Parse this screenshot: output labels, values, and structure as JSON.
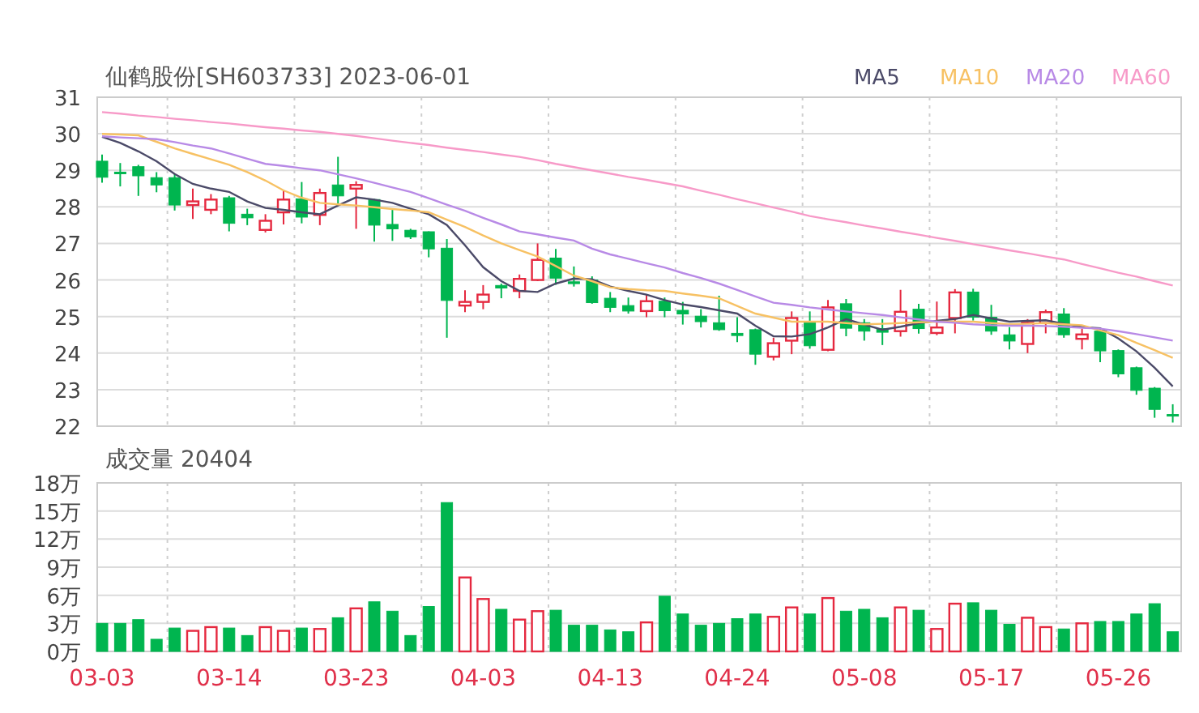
{
  "title": "仙鹤股份[SH603733] 2023-06-01",
  "price_chart": {
    "chart_data": {
      "type": "candlestick",
      "grid": true,
      "ylim": [
        22,
        31
      ],
      "yticks": [
        22,
        23,
        24,
        25,
        26,
        27,
        28,
        29,
        30,
        31
      ],
      "ohlc": [
        [
          29.25,
          29.43,
          28.66,
          28.81
        ],
        [
          28.95,
          29.2,
          28.56,
          28.92
        ],
        [
          29.1,
          29.15,
          28.3,
          28.85
        ],
        [
          28.8,
          28.95,
          28.4,
          28.6
        ],
        [
          28.8,
          28.9,
          27.9,
          28.05
        ],
        [
          28.05,
          28.5,
          27.67,
          28.15
        ],
        [
          27.92,
          28.35,
          27.8,
          28.2
        ],
        [
          28.25,
          28.3,
          27.33,
          27.55
        ],
        [
          27.8,
          27.95,
          27.5,
          27.7
        ],
        [
          27.37,
          27.8,
          27.3,
          27.62
        ],
        [
          27.85,
          28.45,
          27.52,
          28.2
        ],
        [
          28.22,
          28.68,
          27.55,
          27.72
        ],
        [
          27.78,
          28.5,
          27.5,
          28.38
        ],
        [
          28.6,
          29.37,
          28.05,
          28.3
        ],
        [
          28.5,
          28.7,
          27.4,
          28.6
        ],
        [
          28.2,
          28.22,
          27.05,
          27.5
        ],
        [
          27.52,
          27.95,
          27.07,
          27.4
        ],
        [
          27.36,
          27.4,
          27.12,
          27.18
        ],
        [
          27.32,
          27.33,
          26.62,
          26.85
        ],
        [
          26.87,
          27.12,
          24.42,
          25.44
        ],
        [
          25.3,
          25.72,
          25.12,
          25.4
        ],
        [
          25.4,
          25.86,
          25.2,
          25.6
        ],
        [
          25.85,
          25.9,
          25.5,
          25.78
        ],
        [
          25.7,
          26.15,
          25.5,
          26.03
        ],
        [
          26.0,
          27.0,
          25.97,
          26.55
        ],
        [
          26.6,
          26.85,
          25.87,
          26.05
        ],
        [
          25.95,
          26.37,
          25.82,
          25.9
        ],
        [
          26.0,
          26.1,
          25.35,
          25.38
        ],
        [
          25.5,
          25.67,
          25.12,
          25.25
        ],
        [
          25.3,
          25.52,
          25.08,
          25.15
        ],
        [
          25.15,
          25.6,
          24.98,
          25.42
        ],
        [
          25.42,
          25.52,
          24.98,
          25.16
        ],
        [
          25.17,
          25.4,
          24.78,
          25.07
        ],
        [
          25.01,
          25.2,
          24.7,
          24.86
        ],
        [
          24.83,
          25.57,
          24.61,
          24.64
        ],
        [
          24.54,
          24.98,
          24.3,
          24.48
        ],
        [
          24.64,
          24.67,
          23.68,
          23.97
        ],
        [
          23.9,
          24.42,
          23.8,
          24.27
        ],
        [
          24.34,
          25.14,
          23.97,
          24.96
        ],
        [
          24.87,
          25.14,
          24.12,
          24.2
        ],
        [
          24.09,
          25.45,
          24.05,
          25.25
        ],
        [
          25.35,
          25.48,
          24.46,
          24.68
        ],
        [
          24.83,
          24.93,
          24.34,
          24.6
        ],
        [
          24.67,
          24.93,
          24.22,
          24.57
        ],
        [
          24.6,
          25.73,
          24.45,
          25.13
        ],
        [
          25.2,
          25.35,
          24.53,
          24.67
        ],
        [
          24.55,
          25.41,
          24.49,
          24.7
        ],
        [
          24.96,
          25.75,
          24.54,
          25.66
        ],
        [
          25.67,
          25.76,
          24.89,
          24.98
        ],
        [
          24.98,
          25.32,
          24.5,
          24.6
        ],
        [
          24.5,
          24.71,
          24.1,
          24.33
        ],
        [
          24.25,
          24.93,
          24.0,
          24.83
        ],
        [
          24.82,
          25.19,
          24.54,
          25.12
        ],
        [
          25.07,
          25.23,
          24.42,
          24.5
        ],
        [
          24.39,
          24.67,
          24.1,
          24.51
        ],
        [
          24.6,
          24.67,
          23.75,
          24.06
        ],
        [
          24.07,
          24.1,
          23.34,
          23.43
        ],
        [
          23.6,
          23.63,
          22.86,
          22.98
        ],
        [
          23.04,
          23.07,
          22.23,
          22.46
        ],
        [
          22.32,
          22.6,
          22.1,
          22.3
        ]
      ]
    },
    "moving_averages": {
      "chart_data": {
        "type": "line",
        "ylim": [
          22,
          31
        ],
        "series": [
          {
            "name": "MA5",
            "color": "#4b4a68",
            "values": [
              29.92,
              29.75,
              29.52,
              29.25,
              28.9,
              28.63,
              28.5,
              28.41,
              28.15,
              27.97,
              27.92,
              27.85,
              27.8,
              28.04,
              28.26,
              28.2,
              28.11,
              27.95,
              27.8,
              27.5,
              26.95,
              26.35,
              25.97,
              25.7,
              25.67,
              25.9,
              26.04,
              26.02,
              25.82,
              25.7,
              25.6,
              25.45,
              25.33,
              25.26,
              25.17,
              25.08,
              24.75,
              24.46,
              24.45,
              24.52,
              24.7,
              24.93,
              24.78,
              24.64,
              24.72,
              24.82,
              24.88,
              24.93,
              25.04,
              24.95,
              24.86,
              24.88,
              24.9,
              24.8,
              24.71,
              24.68,
              24.4,
              24.05,
              23.6,
              23.09
            ]
          },
          {
            "name": "MA10",
            "color": "#f7c163",
            "values": [
              30.0,
              29.98,
              29.96,
              29.78,
              29.6,
              29.45,
              29.3,
              29.15,
              28.95,
              28.72,
              28.45,
              28.25,
              28.11,
              28.07,
              28.04,
              27.99,
              27.94,
              27.9,
              27.85,
              27.65,
              27.45,
              27.22,
              27.0,
              26.82,
              26.64,
              26.38,
              26.12,
              25.97,
              25.8,
              25.75,
              25.72,
              25.7,
              25.63,
              25.57,
              25.5,
              25.29,
              25.08,
              24.97,
              24.86,
              24.86,
              24.86,
              24.82,
              24.79,
              24.8,
              24.82,
              24.84,
              24.86,
              24.86,
              24.86,
              24.82,
              24.79,
              24.8,
              24.82,
              24.79,
              24.76,
              24.62,
              24.49,
              24.28,
              24.08,
              23.87
            ]
          },
          {
            "name": "MA20",
            "color": "#b88ae6",
            "values": [
              29.93,
              29.9,
              29.88,
              29.85,
              29.77,
              29.68,
              29.6,
              29.46,
              29.32,
              29.18,
              29.12,
              29.06,
              29.0,
              28.89,
              28.78,
              28.66,
              28.53,
              28.41,
              28.24,
              28.06,
              27.89,
              27.7,
              27.52,
              27.33,
              27.25,
              27.16,
              27.08,
              26.86,
              26.7,
              26.58,
              26.46,
              26.34,
              26.19,
              26.05,
              25.9,
              25.73,
              25.55,
              25.38,
              25.32,
              25.25,
              25.19,
              25.14,
              25.09,
              25.04,
              24.98,
              24.92,
              24.86,
              24.83,
              24.79,
              24.76,
              24.75,
              24.75,
              24.74,
              24.72,
              24.69,
              24.67,
              24.6,
              24.52,
              24.43,
              24.34
            ]
          },
          {
            "name": "MA60",
            "color": "#f79ac8",
            "values": [
              30.59,
              30.55,
              30.5,
              30.46,
              30.41,
              30.37,
              30.32,
              30.28,
              30.23,
              30.18,
              30.14,
              30.09,
              30.05,
              30.0,
              29.94,
              29.88,
              29.81,
              29.75,
              29.69,
              29.62,
              29.56,
              29.5,
              29.43,
              29.37,
              29.28,
              29.18,
              29.09,
              29.0,
              28.91,
              28.82,
              28.74,
              28.65,
              28.56,
              28.44,
              28.33,
              28.21,
              28.1,
              27.98,
              27.87,
              27.75,
              27.66,
              27.58,
              27.49,
              27.41,
              27.32,
              27.24,
              27.15,
              27.07,
              26.98,
              26.9,
              26.81,
              26.73,
              26.64,
              26.56,
              26.44,
              26.32,
              26.2,
              26.09,
              25.97,
              25.85
            ]
          }
        ]
      }
    }
  },
  "volume_chart": {
    "chart_data": {
      "type": "bar",
      "grid": true,
      "title": "成交量 20404",
      "ylim": [
        0,
        18
      ],
      "yticks": [
        {
          "value": 0,
          "label": "0万"
        },
        {
          "value": 3,
          "label": "3万"
        },
        {
          "value": 6,
          "label": "6万"
        },
        {
          "value": 9,
          "label": "9万"
        },
        {
          "value": 12,
          "label": "12万"
        },
        {
          "value": 15,
          "label": "15万"
        },
        {
          "value": 18,
          "label": "18万"
        }
      ],
      "categories": [
        "03-03",
        null,
        null,
        null,
        null,
        null,
        null,
        "03-14",
        null,
        null,
        null,
        null,
        null,
        null,
        "03-23",
        null,
        null,
        null,
        null,
        null,
        null,
        "04-03",
        null,
        null,
        null,
        null,
        null,
        null,
        "04-13",
        null,
        null,
        null,
        null,
        null,
        null,
        "04-24",
        null,
        null,
        null,
        null,
        null,
        null,
        "05-08",
        null,
        null,
        null,
        null,
        null,
        null,
        "05-17",
        null,
        null,
        null,
        null,
        null,
        null,
        "05-26",
        null,
        null,
        null
      ],
      "series": [
        {
          "values": [
            3.0,
            3.0,
            3.4,
            1.3,
            2.5,
            2.2,
            2.6,
            2.5,
            1.7,
            2.6,
            2.2,
            2.5,
            2.4,
            3.6,
            4.6,
            5.3,
            4.3,
            1.7,
            4.8,
            15.9,
            7.9,
            5.6,
            4.5,
            3.4,
            4.3,
            4.4,
            2.8,
            2.8,
            2.3,
            2.1,
            3.1,
            5.9,
            4.0,
            2.8,
            3.0,
            3.5,
            4.0,
            3.7,
            4.7,
            4.0,
            5.7,
            4.3,
            4.5,
            3.6,
            4.7,
            4.4,
            2.4,
            5.1,
            5.2,
            4.4,
            2.9,
            3.6,
            2.6,
            2.4,
            3.0,
            3.2,
            3.2,
            4.0,
            5.1,
            2.1
          ]
        }
      ]
    }
  }
}
